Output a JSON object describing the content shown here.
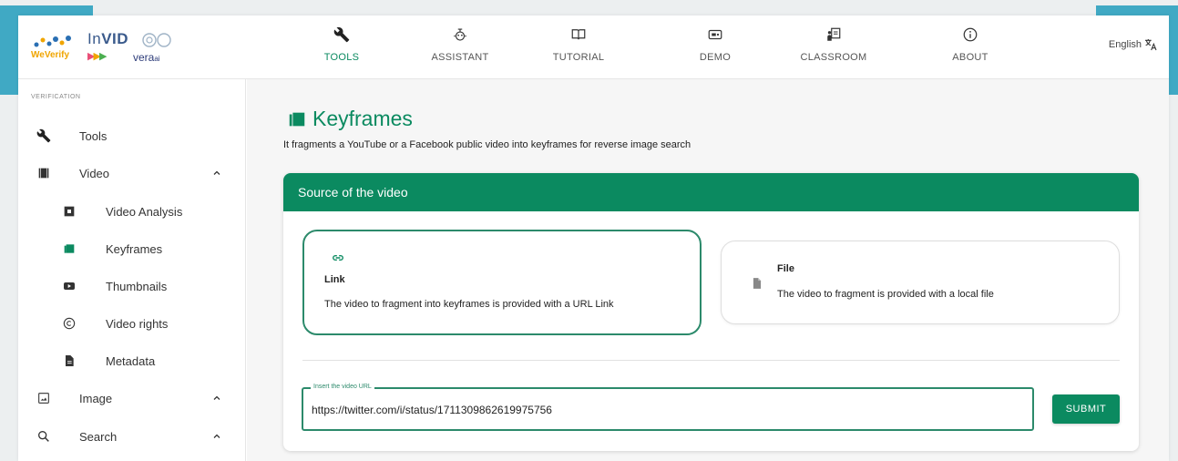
{
  "colors": {
    "accent": "#0b8a60",
    "corner": "#40a9c4"
  },
  "logo": {
    "weverify": "WeVerify",
    "invid_prefix": "In",
    "invid_bold": "VID",
    "vera": "vera",
    "vera_suffix": "ai"
  },
  "nav": [
    {
      "label": "TOOLS",
      "icon": "wrench-icon",
      "active": true
    },
    {
      "label": "ASSISTANT",
      "icon": "assistant-icon",
      "active": false
    },
    {
      "label": "TUTORIAL",
      "icon": "book-icon",
      "active": false
    },
    {
      "label": "DEMO",
      "icon": "demo-icon",
      "active": false
    },
    {
      "label": "CLASSROOM",
      "icon": "classroom-icon",
      "active": false
    },
    {
      "label": "ABOUT",
      "icon": "info-icon",
      "active": false
    }
  ],
  "language": "English",
  "sidebar": {
    "section": "VERIFICATION",
    "items": [
      {
        "label": "Tools",
        "icon": "wrench-icon"
      },
      {
        "label": "Video",
        "icon": "film-icon",
        "expanded": true
      },
      {
        "label": "Video Analysis",
        "icon": "film-icon"
      },
      {
        "label": "Keyframes",
        "icon": "keyframes-icon"
      },
      {
        "label": "Thumbnails",
        "icon": "youtube-icon"
      },
      {
        "label": "Video rights",
        "icon": "copyright-icon"
      },
      {
        "label": "Metadata",
        "icon": "file-icon"
      },
      {
        "label": "Image",
        "icon": "image-icon",
        "expanded": true
      },
      {
        "label": "Search",
        "icon": "search-icon",
        "expanded": true
      }
    ]
  },
  "page": {
    "title": "Keyframes",
    "subtitle": "It fragments a YouTube or a Facebook public video into keyframes for reverse image search"
  },
  "source": {
    "header": "Source of the video",
    "link": {
      "title": "Link",
      "desc": "The video to fragment into keyframes is provided with a URL Link"
    },
    "file": {
      "title": "File",
      "desc": "The video to fragment is provided with a local file"
    },
    "url_label": "Insert the video URL",
    "url_value": "https://twitter.com/i/status/1711309862619975756",
    "submit": "SUBMIT"
  }
}
